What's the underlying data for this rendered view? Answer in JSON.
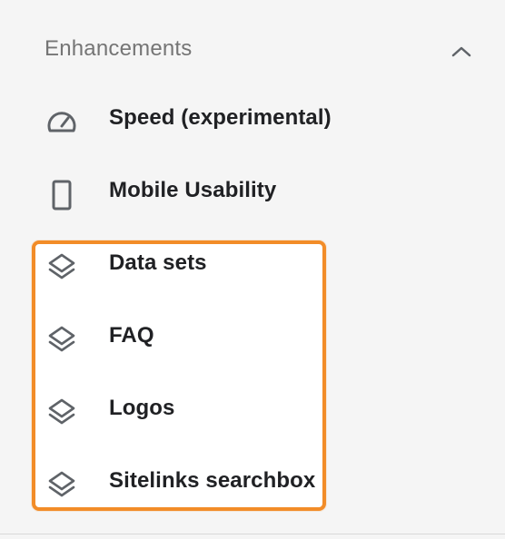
{
  "section": {
    "title": "Enhancements",
    "collapse_icon": "chevron-up-icon"
  },
  "items": [
    {
      "label": "Speed (experimental)",
      "icon": "speedometer-icon"
    },
    {
      "label": "Mobile Usability",
      "icon": "smartphone-icon"
    },
    {
      "label": "Data sets",
      "icon": "layers-icon"
    },
    {
      "label": "FAQ",
      "icon": "layers-icon"
    },
    {
      "label": "Logos",
      "icon": "layers-icon"
    },
    {
      "label": "Sitelinks searchbox",
      "icon": "layers-icon"
    }
  ],
  "colors": {
    "highlight_border": "#f28c28",
    "background": "#f5f5f5",
    "text_primary": "#202124",
    "text_secondary": "#757575",
    "icon": "#5f6368"
  }
}
